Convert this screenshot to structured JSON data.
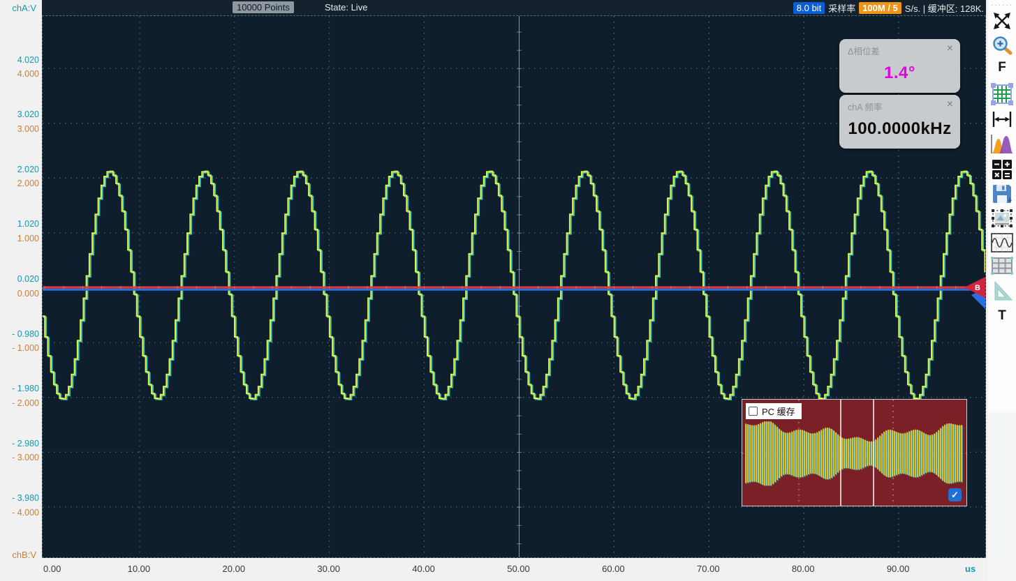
{
  "top_bar": {
    "points_badge": "10000 Points",
    "state_label": "State: Live",
    "bit_badge": "8.0 bit",
    "sample_rate_label": "采样率",
    "sample_rate_badge": "100M / 5",
    "sample_rate_suffix": "S/s. | 缓冲区: 128K."
  },
  "axes": {
    "left_top_label": "chA:V",
    "left_bottom_label": "chB:V",
    "x_unit": "us",
    "y_rows": [
      {
        "chA": "4.020",
        "chB": "4.000",
        "volts": 4
      },
      {
        "chA": "3.020",
        "chB": "3.000",
        "volts": 3
      },
      {
        "chA": "2.020",
        "chB": "2.000",
        "volts": 2
      },
      {
        "chA": "1.020",
        "chB": "1.000",
        "volts": 1
      },
      {
        "chA": "0.020",
        "chB": "0.000",
        "volts": 0
      },
      {
        "chA": "- 0.980",
        "chB": "- 1.000",
        "volts": -1
      },
      {
        "chA": "- 1.980",
        "chB": "- 2.000",
        "volts": -2
      },
      {
        "chA": "- 2.980",
        "chB": "- 3.000",
        "volts": -3
      },
      {
        "chA": "- 3.980",
        "chB": "- 4.000",
        "volts": -4
      }
    ],
    "x_ticks": [
      "0.00",
      "10.00",
      "20.00",
      "30.00",
      "40.00",
      "50.00",
      "60.00",
      "70.00",
      "80.00",
      "90.00"
    ]
  },
  "measurements": [
    {
      "title": "Δ相位差",
      "value": "1.4°",
      "value_color": "#e101e1",
      "close_icon": "×"
    },
    {
      "title": "chA 频率",
      "value": "100.0000kHz",
      "value_color": "#0b0b0b",
      "close_icon": "×"
    }
  ],
  "markers": {
    "b_marker_label": "B"
  },
  "buffer_panel": {
    "checkbox_label": "PC 缓存",
    "checkbox_checked": false,
    "confirm_checked": true,
    "check_icon": "✓"
  },
  "toolbar": {
    "f_label": "F",
    "t_label": "T",
    "icons": [
      "drag-handle",
      "expand-fullscreen",
      "zoom-in",
      "fft-f",
      "grid-settings",
      "horizontal-measure",
      "histogram",
      "math-operations",
      "save",
      "screenshot",
      "waveform-display",
      "data-table",
      "measure-ruler",
      "trigger-t"
    ]
  },
  "colors": {
    "plot_bg": "#0e1e2c",
    "top_bar_bg": "#15222e",
    "chA_trace": "#37c5c5",
    "chB_trace": "#e4ee3e",
    "chA_label": "#1698ad",
    "chB_label": "#c4803e",
    "zero_line_red": "#e23b3b",
    "zero_line_blue": "#2e6ee0",
    "buffer_bg": "#7b2026",
    "buffer_wave": "#f2da36",
    "bit_badge_bg": "#0a5cd7",
    "rate_badge_bg": "#ef9416",
    "phase_value": "#e101e1"
  },
  "chart_data": {
    "type": "line",
    "signal": "stepped sine (quantized DAC output), two nearly-overlapping channels",
    "channels": [
      {
        "name": "chA",
        "color": "#37c5c5"
      },
      {
        "name": "chB",
        "color": "#e4ee3e"
      }
    ],
    "frequency_khz": 100,
    "period_us": 10,
    "amplitude_v": 2.08,
    "dc_offset_v": 0.05,
    "phase_difference_deg": 1.4,
    "first_trough_us": 1.76,
    "x_range_us": [
      0,
      99.3
    ],
    "x_tick_step_us": 10,
    "y_range_v": [
      -4.95,
      4.95
    ],
    "y_tick_step_v": 1,
    "quantization_step_us": 0.3125,
    "grid": "dotted",
    "x_unit": "us",
    "y_unit": "V",
    "zero_reference_lines": [
      {
        "channel": "chB",
        "color": "#e23b3b",
        "level_v": 0
      },
      {
        "channel": "chA",
        "color": "#2e6ee0",
        "level_v": 0
      }
    ]
  }
}
